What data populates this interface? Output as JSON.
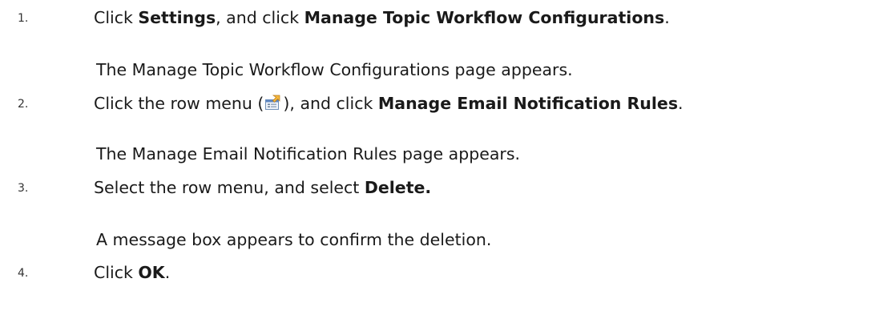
{
  "steps": [
    {
      "number": "1.",
      "parts": {
        "a": "Click ",
        "b1": "Settings",
        "c": ", and click ",
        "b2": "Manage Topic Workflow Configurations",
        "d": "."
      },
      "result": "The Manage Topic Workflow Configurations page appears."
    },
    {
      "number": "2.",
      "parts": {
        "a": "Click the row menu (",
        "icon": "row-menu-icon",
        "c": "), and click ",
        "b2": "Manage Email Notification Rules",
        "d": "."
      },
      "result": "The Manage Email Notification Rules page appears."
    },
    {
      "number": "3.",
      "parts": {
        "a": "Select the row menu, and select ",
        "b2": "Delete."
      },
      "result": "A message box appears to confirm the deletion."
    },
    {
      "number": "4.",
      "parts": {
        "a": "Click ",
        "b2": "OK",
        "d": "."
      }
    }
  ]
}
